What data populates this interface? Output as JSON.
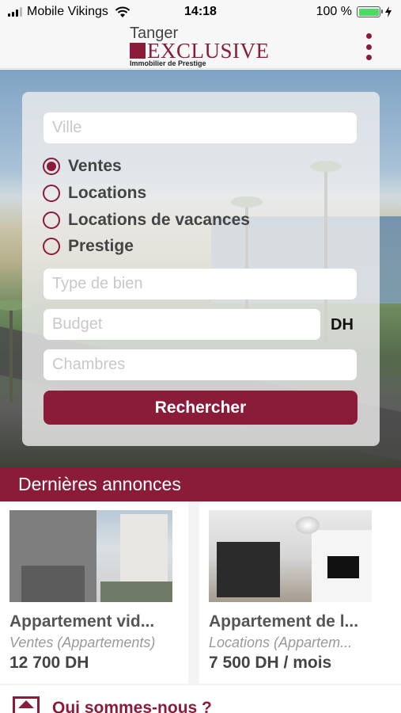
{
  "status_bar": {
    "carrier": "Mobile Vikings",
    "time": "14:18",
    "battery": "100 %"
  },
  "header": {
    "logo_top": "Tanger",
    "logo_main": "EXCLUSIVE",
    "logo_tagline": "Immobilier de Prestige",
    "menu_icon": "kebab-menu-icon"
  },
  "search": {
    "city_placeholder": "Ville",
    "options": [
      {
        "label": "Ventes",
        "checked": true
      },
      {
        "label": "Locations",
        "checked": false
      },
      {
        "label": "Locations de vacances",
        "checked": false
      },
      {
        "label": "Prestige",
        "checked": false
      }
    ],
    "type_placeholder": "Type de bien",
    "budget_placeholder": "Budget",
    "currency": "DH",
    "rooms_placeholder": "Chambres",
    "button": "Rechercher"
  },
  "latest": {
    "title": "Dernières annonces",
    "listings": [
      {
        "title": "Appartement vid...",
        "category": "Ventes  (Appartements)",
        "price": "12 700 DH"
      },
      {
        "title": "Appartement de l...",
        "category": "Locations  (Appartem...",
        "price": "7 500 DH / mois"
      }
    ]
  },
  "about": {
    "label": "Qui sommes-nous ?",
    "icon": "home-icon"
  },
  "colors": {
    "accent": "#8a1c3a"
  }
}
